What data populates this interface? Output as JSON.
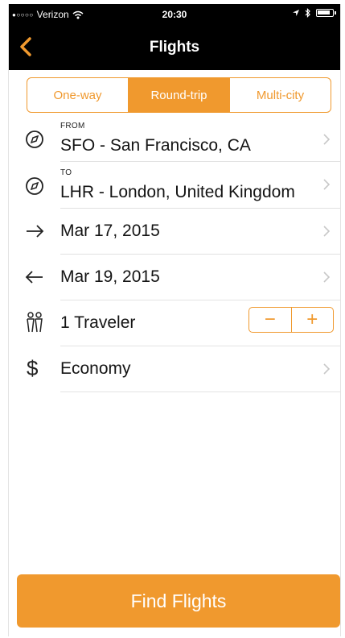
{
  "status_bar": {
    "signal_dots": "●○○○○",
    "carrier": "Verizon",
    "time": "20:30",
    "icons": [
      "wifi-icon",
      "location-arrow-icon",
      "bluetooth-icon",
      "battery-icon"
    ]
  },
  "nav": {
    "title": "Flights",
    "back_icon": "chevron-left-icon"
  },
  "trip_type": {
    "options": [
      "One-way",
      "Round-trip",
      "Multi-city"
    ],
    "selected": "Round-trip"
  },
  "form": {
    "from": {
      "label": "FROM",
      "value": "SFO - San Francisco, CA",
      "icon": "compass-icon"
    },
    "to": {
      "label": "TO",
      "value": "LHR - London, United Kingdom",
      "icon": "compass-icon"
    },
    "depart_date": {
      "value": "Mar 17, 2015",
      "icon": "arrow-right-icon"
    },
    "return_date": {
      "value": "Mar 19, 2015",
      "icon": "arrow-left-icon"
    },
    "travelers": {
      "value": "1 Traveler",
      "icon": "travelers-icon",
      "minus": "−",
      "plus": "+"
    },
    "cabin": {
      "value": "Economy",
      "icon": "dollar-icon",
      "symbol": "$"
    }
  },
  "find_button": {
    "label": "Find Flights"
  },
  "colors": {
    "accent": "#f0992e",
    "bar": "#000000",
    "divider": "#e2e2e2"
  }
}
